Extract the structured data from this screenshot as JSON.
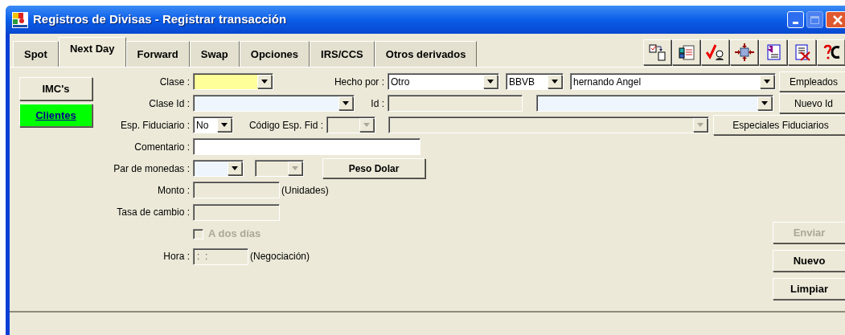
{
  "window": {
    "title": "Registros de Divisas - Registrar transacción"
  },
  "tabs": [
    {
      "label": "Spot",
      "selected": false
    },
    {
      "label": "Next Day",
      "selected": true
    },
    {
      "label": "Forward",
      "selected": false
    },
    {
      "label": "Swap",
      "selected": false
    },
    {
      "label": "Opciones",
      "selected": false
    },
    {
      "label": "IRS/CCS",
      "selected": false
    },
    {
      "label": "Otros derivados",
      "selected": false
    }
  ],
  "side_buttons": [
    {
      "label": "IMC's",
      "highlighted": false
    },
    {
      "label": "Clientes",
      "highlighted": true
    }
  ],
  "form": {
    "clase": {
      "label": "Clase :",
      "color": "#ffff99",
      "disabled": false
    },
    "hecho_por": {
      "label": "Hecho por :",
      "value": "Otro",
      "disabled": false
    },
    "banco": {
      "value": "BBVB",
      "disabled": false
    },
    "usuario": {
      "value": "hernando Angel",
      "disabled": false
    },
    "empleados_button": {
      "label": "Empleados"
    },
    "clase_id": {
      "label": "Clase Id :",
      "color": "#eef5fd",
      "disabled": false
    },
    "id": {
      "label": "Id :",
      "disabled": true
    },
    "id_combo": {
      "color": "#eef5fd",
      "disabled": false
    },
    "nuevo_id_button": {
      "label": "Nuevo Id"
    },
    "esp_fiduciario": {
      "label": "Esp. Fiduciario :",
      "value": "No",
      "disabled": false
    },
    "codigo_esp_fid": {
      "label": "Código Esp. Fid :",
      "disabled": true
    },
    "codigo_descripcion": {
      "disabled": true
    },
    "especiales_button": {
      "label": "Especiales Fiduciarios"
    },
    "comentario": {
      "label": "Comentario :",
      "disabled": false
    },
    "par_de_monedas": {
      "label": "Par de monedas :",
      "color": "#eef5fd",
      "disabled": false
    },
    "moneda_2": {
      "disabled": true
    },
    "peso_dolar_button": {
      "label": "Peso Dolar"
    },
    "monto": {
      "label": "Monto :",
      "disabled": true,
      "unit": "(Unidades)"
    },
    "tasa": {
      "label": "Tasa de cambio :",
      "disabled": true
    },
    "a_dos_dias": {
      "label": "A dos días",
      "checked": false,
      "disabled": true
    },
    "hora": {
      "label": "Hora :",
      "value": ":  :",
      "disabled": true,
      "unit": "(Negociación)"
    }
  },
  "actions": [
    {
      "label": "Enviar",
      "disabled": true
    },
    {
      "label": "Nuevo",
      "disabled": false
    },
    {
      "label": "Limpiar",
      "disabled": false
    }
  ]
}
